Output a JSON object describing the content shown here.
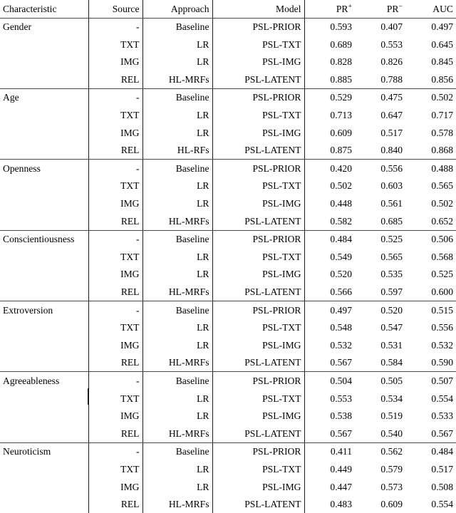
{
  "table": {
    "columns": [
      {
        "key": "characteristic",
        "label": "Characteristic",
        "align": "left"
      },
      {
        "key": "source",
        "label": "Source",
        "align": "right"
      },
      {
        "key": "approach",
        "label": "Approach",
        "align": "right"
      },
      {
        "key": "model",
        "label": "Model",
        "align": "right"
      },
      {
        "key": "pr_plus",
        "label": "PR",
        "sup": "+",
        "align": "right"
      },
      {
        "key": "pr_minus",
        "label": "PR",
        "sup": "−",
        "align": "right"
      },
      {
        "key": "auc",
        "label": "AUC",
        "align": "right"
      }
    ],
    "header": {
      "characteristic": "Characteristic",
      "source": "Source",
      "approach": "Approach",
      "model": "Model",
      "pr_plus_base": "PR",
      "pr_plus_sup": "+",
      "pr_minus_base": "PR",
      "pr_minus_sup": "−",
      "auc": "AUC"
    },
    "blocks": [
      {
        "characteristic": "Gender",
        "rows": [
          {
            "source": "-",
            "approach": "Baseline",
            "model": "PSL-PRIOR",
            "pr_plus": "0.593",
            "pr_minus": "0.407",
            "auc": "0.497",
            "bold": []
          },
          {
            "source": "TXT",
            "approach": "LR",
            "model": "PSL-TXT",
            "pr_plus": "0.689",
            "pr_minus": "0.553",
            "auc": "0.645",
            "bold": []
          },
          {
            "source": "IMG",
            "approach": "LR",
            "model": "PSL-IMG",
            "pr_plus": "0.828",
            "pr_minus": "0.826",
            "auc": "0.845",
            "bold": [
              "pr_minus"
            ]
          },
          {
            "source": "REL",
            "approach": "HL-MRFs",
            "model": "PSL-LATENT",
            "pr_plus": "0.885",
            "pr_minus": "0.788",
            "auc": "0.856",
            "bold": [
              "pr_plus",
              "auc"
            ]
          }
        ]
      },
      {
        "characteristic": "Age",
        "rows": [
          {
            "source": "-",
            "approach": "Baseline",
            "model": "PSL-PRIOR",
            "pr_plus": "0.529",
            "pr_minus": "0.475",
            "auc": "0.502",
            "bold": []
          },
          {
            "source": "TXT",
            "approach": "LR",
            "model": "PSL-TXT",
            "pr_plus": "0.713",
            "pr_minus": "0.647",
            "auc": "0.717",
            "bold": []
          },
          {
            "source": "IMG",
            "approach": "LR",
            "model": "PSL-IMG",
            "pr_plus": "0.609",
            "pr_minus": "0.517",
            "auc": "0.578",
            "bold": []
          },
          {
            "source": "REL",
            "approach": "HL-RFs",
            "model": "PSL-LATENT",
            "pr_plus": "0.875",
            "pr_minus": "0.840",
            "auc": "0.868",
            "bold": [
              "pr_plus",
              "pr_minus",
              "auc"
            ]
          }
        ]
      },
      {
        "characteristic": "Openness",
        "rows": [
          {
            "source": "-",
            "approach": "Baseline",
            "model": "PSL-PRIOR",
            "pr_plus": "0.420",
            "pr_minus": "0.556",
            "auc": "0.488",
            "bold": []
          },
          {
            "source": "TXT",
            "approach": "LR",
            "model": "PSL-TXT",
            "pr_plus": "0.502",
            "pr_minus": "0.603",
            "auc": "0.565",
            "bold": []
          },
          {
            "source": "IMG",
            "approach": "LR",
            "model": "PSL-IMG",
            "pr_plus": "0.448",
            "pr_minus": "0.561",
            "auc": "0.502",
            "bold": []
          },
          {
            "source": "REL",
            "approach": "HL-MRFs",
            "model": "PSL-LATENT",
            "pr_plus": "0.582",
            "pr_minus": "0.685",
            "auc": "0.652",
            "bold": [
              "pr_plus",
              "pr_minus",
              "auc"
            ]
          }
        ]
      },
      {
        "characteristic": "Conscientiousness",
        "rows": [
          {
            "source": "-",
            "approach": "Baseline",
            "model": "PSL-PRIOR",
            "pr_plus": "0.484",
            "pr_minus": "0.525",
            "auc": "0.506",
            "bold": []
          },
          {
            "source": "TXT",
            "approach": "LR",
            "model": "PSL-TXT",
            "pr_plus": "0.549",
            "pr_minus": "0.565",
            "auc": "0.568",
            "bold": []
          },
          {
            "source": "IMG",
            "approach": "LR",
            "model": "PSL-IMG",
            "pr_plus": "0.520",
            "pr_minus": "0.535",
            "auc": "0.525",
            "bold": []
          },
          {
            "source": "REL",
            "approach": "HL-MRFs",
            "model": "PSL-LATENT",
            "pr_plus": "0.566",
            "pr_minus": "0.597",
            "auc": "0.600",
            "bold": [
              "pr_plus",
              "pr_minus",
              "auc"
            ]
          }
        ]
      },
      {
        "characteristic": "Extroversion",
        "rows": [
          {
            "source": "-",
            "approach": "Baseline",
            "model": "PSL-PRIOR",
            "pr_plus": "0.497",
            "pr_minus": "0.520",
            "auc": "0.515",
            "bold": []
          },
          {
            "source": "TXT",
            "approach": "LR",
            "model": "PSL-TXT",
            "pr_plus": "0.548",
            "pr_minus": "0.547",
            "auc": "0.556",
            "bold": []
          },
          {
            "source": "IMG",
            "approach": "LR",
            "model": "PSL-IMG",
            "pr_plus": "0.532",
            "pr_minus": "0.531",
            "auc": "0.532",
            "bold": []
          },
          {
            "source": "REL",
            "approach": "HL-MRFs",
            "model": "PSL-LATENT",
            "pr_plus": "0.567",
            "pr_minus": "0.584",
            "auc": "0.590",
            "bold": [
              "pr_plus",
              "pr_minus",
              "auc"
            ]
          }
        ]
      },
      {
        "characteristic": "Agreeableness",
        "rows": [
          {
            "source": "-",
            "approach": "Baseline",
            "model": "PSL-PRIOR",
            "pr_plus": "0.504",
            "pr_minus": "0.505",
            "auc": "0.507",
            "bold": []
          },
          {
            "source": "TXT",
            "approach": "LR",
            "model": "PSL-TXT",
            "pr_plus": "0.553",
            "pr_minus": "0.534",
            "auc": "0.554",
            "bold": []
          },
          {
            "source": "IMG",
            "approach": "LR",
            "model": "PSL-IMG",
            "pr_plus": "0.538",
            "pr_minus": "0.519",
            "auc": "0.533",
            "bold": []
          },
          {
            "source": "REL",
            "approach": "HL-MRFs",
            "model": "PSL-LATENT",
            "pr_plus": "0.567",
            "pr_minus": "0.540",
            "auc": "0.567",
            "bold": [
              "pr_plus",
              "pr_minus",
              "auc"
            ]
          }
        ]
      },
      {
        "characteristic": "Neuroticism",
        "rows": [
          {
            "source": "-",
            "approach": "Baseline",
            "model": "PSL-PRIOR",
            "pr_plus": "0.411",
            "pr_minus": "0.562",
            "auc": "0.484",
            "bold": []
          },
          {
            "source": "TXT",
            "approach": "LR",
            "model": "PSL-TXT",
            "pr_plus": "0.449",
            "pr_minus": "0.579",
            "auc": "0.517",
            "bold": []
          },
          {
            "source": "IMG",
            "approach": "LR",
            "model": "PSL-IMG",
            "pr_plus": "0.447",
            "pr_minus": "0.573",
            "auc": "0.508",
            "bold": []
          },
          {
            "source": "REL",
            "approach": "HL-MRFs",
            "model": "PSL-LATENT",
            "pr_plus": "0.483",
            "pr_minus": "0.609",
            "auc": "0.554",
            "bold": [
              "pr_plus",
              "pr_minus",
              "auc"
            ]
          }
        ]
      }
    ]
  },
  "chart_data": {
    "type": "table",
    "title": "",
    "columns": [
      "Characteristic",
      "Source",
      "Approach",
      "Model",
      "PR+",
      "PR-",
      "AUC"
    ],
    "rows": [
      [
        "Gender",
        "-",
        "Baseline",
        "PSL-PRIOR",
        0.593,
        0.407,
        0.497
      ],
      [
        "Gender",
        "TXT",
        "LR",
        "PSL-TXT",
        0.689,
        0.553,
        0.645
      ],
      [
        "Gender",
        "IMG",
        "LR",
        "PSL-IMG",
        0.828,
        0.826,
        0.845
      ],
      [
        "Gender",
        "REL",
        "HL-MRFs",
        "PSL-LATENT",
        0.885,
        0.788,
        0.856
      ],
      [
        "Age",
        "-",
        "Baseline",
        "PSL-PRIOR",
        0.529,
        0.475,
        0.502
      ],
      [
        "Age",
        "TXT",
        "LR",
        "PSL-TXT",
        0.713,
        0.647,
        0.717
      ],
      [
        "Age",
        "IMG",
        "LR",
        "PSL-IMG",
        0.609,
        0.517,
        0.578
      ],
      [
        "Age",
        "REL",
        "HL-RFs",
        "PSL-LATENT",
        0.875,
        0.84,
        0.868
      ],
      [
        "Openness",
        "-",
        "Baseline",
        "PSL-PRIOR",
        0.42,
        0.556,
        0.488
      ],
      [
        "Openness",
        "TXT",
        "LR",
        "PSL-TXT",
        0.502,
        0.603,
        0.565
      ],
      [
        "Openness",
        "IMG",
        "LR",
        "PSL-IMG",
        0.448,
        0.561,
        0.502
      ],
      [
        "Openness",
        "REL",
        "HL-MRFs",
        "PSL-LATENT",
        0.582,
        0.685,
        0.652
      ],
      [
        "Conscientiousness",
        "-",
        "Baseline",
        "PSL-PRIOR",
        0.484,
        0.525,
        0.506
      ],
      [
        "Conscientiousness",
        "TXT",
        "LR",
        "PSL-TXT",
        0.549,
        0.565,
        0.568
      ],
      [
        "Conscientiousness",
        "IMG",
        "LR",
        "PSL-IMG",
        0.52,
        0.535,
        0.525
      ],
      [
        "Conscientiousness",
        "REL",
        "HL-MRFs",
        "PSL-LATENT",
        0.566,
        0.597,
        0.6
      ],
      [
        "Extroversion",
        "-",
        "Baseline",
        "PSL-PRIOR",
        0.497,
        0.52,
        0.515
      ],
      [
        "Extroversion",
        "TXT",
        "LR",
        "PSL-TXT",
        0.548,
        0.547,
        0.556
      ],
      [
        "Extroversion",
        "IMG",
        "LR",
        "PSL-IMG",
        0.532,
        0.531,
        0.532
      ],
      [
        "Extroversion",
        "REL",
        "HL-MRFs",
        "PSL-LATENT",
        0.567,
        0.584,
        0.59
      ],
      [
        "Agreeableness",
        "-",
        "Baseline",
        "PSL-PRIOR",
        0.504,
        0.505,
        0.507
      ],
      [
        "Agreeableness",
        "TXT",
        "LR",
        "PSL-TXT",
        0.553,
        0.534,
        0.554
      ],
      [
        "Agreeableness",
        "IMG",
        "LR",
        "PSL-IMG",
        0.538,
        0.519,
        0.533
      ],
      [
        "Agreeableness",
        "REL",
        "HL-MRFs",
        "PSL-LATENT",
        0.567,
        0.54,
        0.567
      ],
      [
        "Neuroticism",
        "-",
        "Baseline",
        "PSL-PRIOR",
        0.411,
        0.562,
        0.484
      ],
      [
        "Neuroticism",
        "TXT",
        "LR",
        "PSL-TXT",
        0.449,
        0.579,
        0.517
      ],
      [
        "Neuroticism",
        "IMG",
        "LR",
        "PSL-IMG",
        0.447,
        0.573,
        0.508
      ],
      [
        "Neuroticism",
        "REL",
        "HL-MRFs",
        "PSL-LATENT",
        0.483,
        0.609,
        0.554
      ]
    ]
  }
}
